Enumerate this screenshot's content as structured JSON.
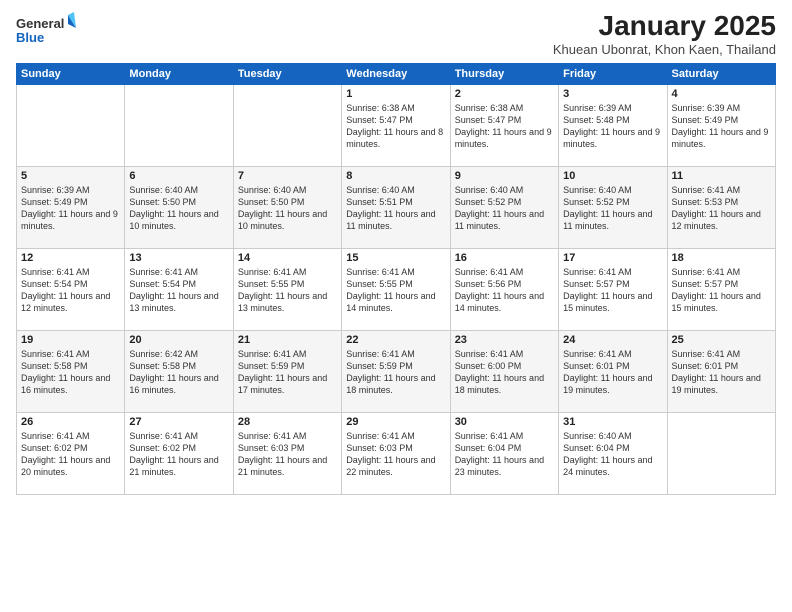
{
  "logo": {
    "general": "General",
    "blue": "Blue"
  },
  "title": "January 2025",
  "subtitle": "Khuean Ubonrat, Khon Kaen, Thailand",
  "headers": [
    "Sunday",
    "Monday",
    "Tuesday",
    "Wednesday",
    "Thursday",
    "Friday",
    "Saturday"
  ],
  "weeks": [
    [
      {
        "day": "",
        "sunrise": "",
        "sunset": "",
        "daylight": ""
      },
      {
        "day": "",
        "sunrise": "",
        "sunset": "",
        "daylight": ""
      },
      {
        "day": "",
        "sunrise": "",
        "sunset": "",
        "daylight": ""
      },
      {
        "day": "1",
        "sunrise": "Sunrise: 6:38 AM",
        "sunset": "Sunset: 5:47 PM",
        "daylight": "Daylight: 11 hours and 8 minutes."
      },
      {
        "day": "2",
        "sunrise": "Sunrise: 6:38 AM",
        "sunset": "Sunset: 5:47 PM",
        "daylight": "Daylight: 11 hours and 9 minutes."
      },
      {
        "day": "3",
        "sunrise": "Sunrise: 6:39 AM",
        "sunset": "Sunset: 5:48 PM",
        "daylight": "Daylight: 11 hours and 9 minutes."
      },
      {
        "day": "4",
        "sunrise": "Sunrise: 6:39 AM",
        "sunset": "Sunset: 5:49 PM",
        "daylight": "Daylight: 11 hours and 9 minutes."
      }
    ],
    [
      {
        "day": "5",
        "sunrise": "Sunrise: 6:39 AM",
        "sunset": "Sunset: 5:49 PM",
        "daylight": "Daylight: 11 hours and 9 minutes."
      },
      {
        "day": "6",
        "sunrise": "Sunrise: 6:40 AM",
        "sunset": "Sunset: 5:50 PM",
        "daylight": "Daylight: 11 hours and 10 minutes."
      },
      {
        "day": "7",
        "sunrise": "Sunrise: 6:40 AM",
        "sunset": "Sunset: 5:50 PM",
        "daylight": "Daylight: 11 hours and 10 minutes."
      },
      {
        "day": "8",
        "sunrise": "Sunrise: 6:40 AM",
        "sunset": "Sunset: 5:51 PM",
        "daylight": "Daylight: 11 hours and 11 minutes."
      },
      {
        "day": "9",
        "sunrise": "Sunrise: 6:40 AM",
        "sunset": "Sunset: 5:52 PM",
        "daylight": "Daylight: 11 hours and 11 minutes."
      },
      {
        "day": "10",
        "sunrise": "Sunrise: 6:40 AM",
        "sunset": "Sunset: 5:52 PM",
        "daylight": "Daylight: 11 hours and 11 minutes."
      },
      {
        "day": "11",
        "sunrise": "Sunrise: 6:41 AM",
        "sunset": "Sunset: 5:53 PM",
        "daylight": "Daylight: 11 hours and 12 minutes."
      }
    ],
    [
      {
        "day": "12",
        "sunrise": "Sunrise: 6:41 AM",
        "sunset": "Sunset: 5:54 PM",
        "daylight": "Daylight: 11 hours and 12 minutes."
      },
      {
        "day": "13",
        "sunrise": "Sunrise: 6:41 AM",
        "sunset": "Sunset: 5:54 PM",
        "daylight": "Daylight: 11 hours and 13 minutes."
      },
      {
        "day": "14",
        "sunrise": "Sunrise: 6:41 AM",
        "sunset": "Sunset: 5:55 PM",
        "daylight": "Daylight: 11 hours and 13 minutes."
      },
      {
        "day": "15",
        "sunrise": "Sunrise: 6:41 AM",
        "sunset": "Sunset: 5:55 PM",
        "daylight": "Daylight: 11 hours and 14 minutes."
      },
      {
        "day": "16",
        "sunrise": "Sunrise: 6:41 AM",
        "sunset": "Sunset: 5:56 PM",
        "daylight": "Daylight: 11 hours and 14 minutes."
      },
      {
        "day": "17",
        "sunrise": "Sunrise: 6:41 AM",
        "sunset": "Sunset: 5:57 PM",
        "daylight": "Daylight: 11 hours and 15 minutes."
      },
      {
        "day": "18",
        "sunrise": "Sunrise: 6:41 AM",
        "sunset": "Sunset: 5:57 PM",
        "daylight": "Daylight: 11 hours and 15 minutes."
      }
    ],
    [
      {
        "day": "19",
        "sunrise": "Sunrise: 6:41 AM",
        "sunset": "Sunset: 5:58 PM",
        "daylight": "Daylight: 11 hours and 16 minutes."
      },
      {
        "day": "20",
        "sunrise": "Sunrise: 6:42 AM",
        "sunset": "Sunset: 5:58 PM",
        "daylight": "Daylight: 11 hours and 16 minutes."
      },
      {
        "day": "21",
        "sunrise": "Sunrise: 6:41 AM",
        "sunset": "Sunset: 5:59 PM",
        "daylight": "Daylight: 11 hours and 17 minutes."
      },
      {
        "day": "22",
        "sunrise": "Sunrise: 6:41 AM",
        "sunset": "Sunset: 5:59 PM",
        "daylight": "Daylight: 11 hours and 18 minutes."
      },
      {
        "day": "23",
        "sunrise": "Sunrise: 6:41 AM",
        "sunset": "Sunset: 6:00 PM",
        "daylight": "Daylight: 11 hours and 18 minutes."
      },
      {
        "day": "24",
        "sunrise": "Sunrise: 6:41 AM",
        "sunset": "Sunset: 6:01 PM",
        "daylight": "Daylight: 11 hours and 19 minutes."
      },
      {
        "day": "25",
        "sunrise": "Sunrise: 6:41 AM",
        "sunset": "Sunset: 6:01 PM",
        "daylight": "Daylight: 11 hours and 19 minutes."
      }
    ],
    [
      {
        "day": "26",
        "sunrise": "Sunrise: 6:41 AM",
        "sunset": "Sunset: 6:02 PM",
        "daylight": "Daylight: 11 hours and 20 minutes."
      },
      {
        "day": "27",
        "sunrise": "Sunrise: 6:41 AM",
        "sunset": "Sunset: 6:02 PM",
        "daylight": "Daylight: 11 hours and 21 minutes."
      },
      {
        "day": "28",
        "sunrise": "Sunrise: 6:41 AM",
        "sunset": "Sunset: 6:03 PM",
        "daylight": "Daylight: 11 hours and 21 minutes."
      },
      {
        "day": "29",
        "sunrise": "Sunrise: 6:41 AM",
        "sunset": "Sunset: 6:03 PM",
        "daylight": "Daylight: 11 hours and 22 minutes."
      },
      {
        "day": "30",
        "sunrise": "Sunrise: 6:41 AM",
        "sunset": "Sunset: 6:04 PM",
        "daylight": "Daylight: 11 hours and 23 minutes."
      },
      {
        "day": "31",
        "sunrise": "Sunrise: 6:40 AM",
        "sunset": "Sunset: 6:04 PM",
        "daylight": "Daylight: 11 hours and 24 minutes."
      },
      {
        "day": "",
        "sunrise": "",
        "sunset": "",
        "daylight": ""
      }
    ]
  ]
}
